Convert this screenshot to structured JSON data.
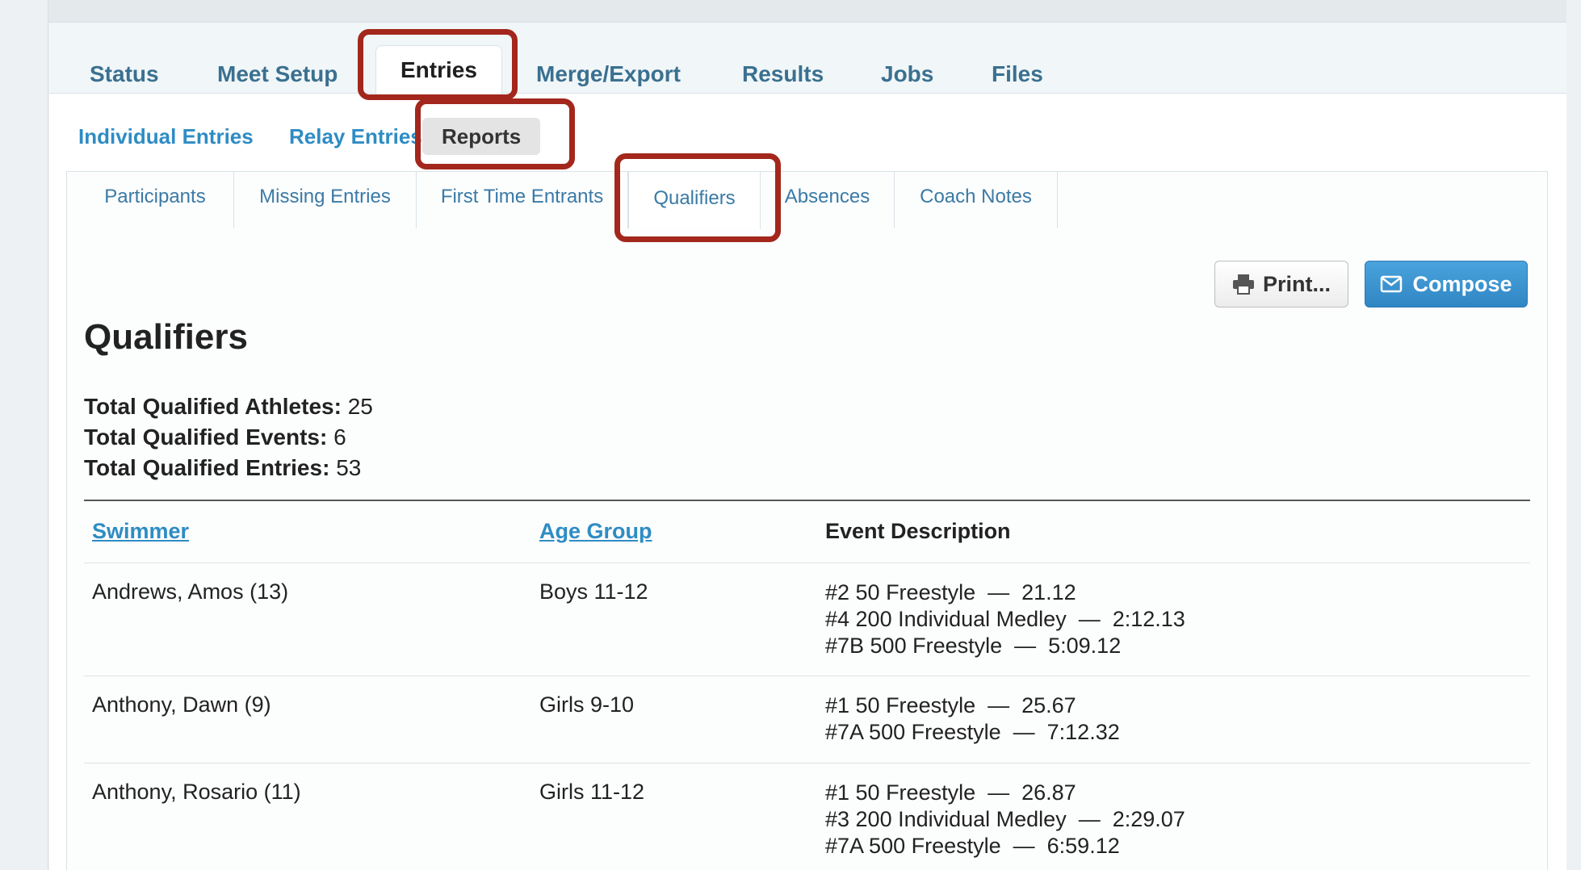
{
  "main_tabs": [
    {
      "label": "Status"
    },
    {
      "label": "Meet Setup"
    },
    {
      "label": "Entries"
    },
    {
      "label": "Merge/Export"
    },
    {
      "label": "Results"
    },
    {
      "label": "Jobs"
    },
    {
      "label": "Files"
    }
  ],
  "sub_tabs": [
    {
      "label": "Individual Entries"
    },
    {
      "label": "Relay Entries"
    },
    {
      "label": "Reports"
    }
  ],
  "report_tabs": [
    {
      "label": "Participants"
    },
    {
      "label": "Missing Entries"
    },
    {
      "label": "First Time Entrants"
    },
    {
      "label": "Qualifiers"
    },
    {
      "label": "Absences"
    },
    {
      "label": "Coach Notes"
    }
  ],
  "actions": {
    "print_label": "Print...",
    "compose_label": "Compose",
    "print_icon": "printer-icon",
    "compose_icon": "envelope-icon"
  },
  "page_title": "Qualifiers",
  "stats": [
    {
      "label": "Total Qualified Athletes:",
      "value": "25"
    },
    {
      "label": "Total Qualified Events:",
      "value": "6"
    },
    {
      "label": "Total Qualified Entries:",
      "value": "53"
    }
  ],
  "table": {
    "headers": {
      "swimmer": "Swimmer",
      "age_group": "Age Group",
      "event": "Event Description"
    },
    "rows": [
      {
        "swimmer": "Andrews, Amos (13)",
        "age_group": "Boys 11-12",
        "events": [
          "#2 50 Freestyle  —  21.12",
          "#4 200 Individual Medley  —  2:12.13",
          "#7B 500 Freestyle  —  5:09.12"
        ]
      },
      {
        "swimmer": "Anthony, Dawn (9)",
        "age_group": "Girls 9-10",
        "events": [
          "#1 50 Freestyle  —  25.67",
          "#7A 500 Freestyle  —  7:12.32"
        ]
      },
      {
        "swimmer": "Anthony, Rosario (11)",
        "age_group": "Girls 11-12",
        "events": [
          "#1 50 Freestyle  —  26.87",
          "#3 200 Individual Medley  —  2:29.07",
          "#7A 500 Freestyle  —  6:59.12"
        ]
      }
    ]
  },
  "colors": {
    "highlight": "#a3271c",
    "link": "#2e8cc4",
    "compose": "#3593d0"
  }
}
